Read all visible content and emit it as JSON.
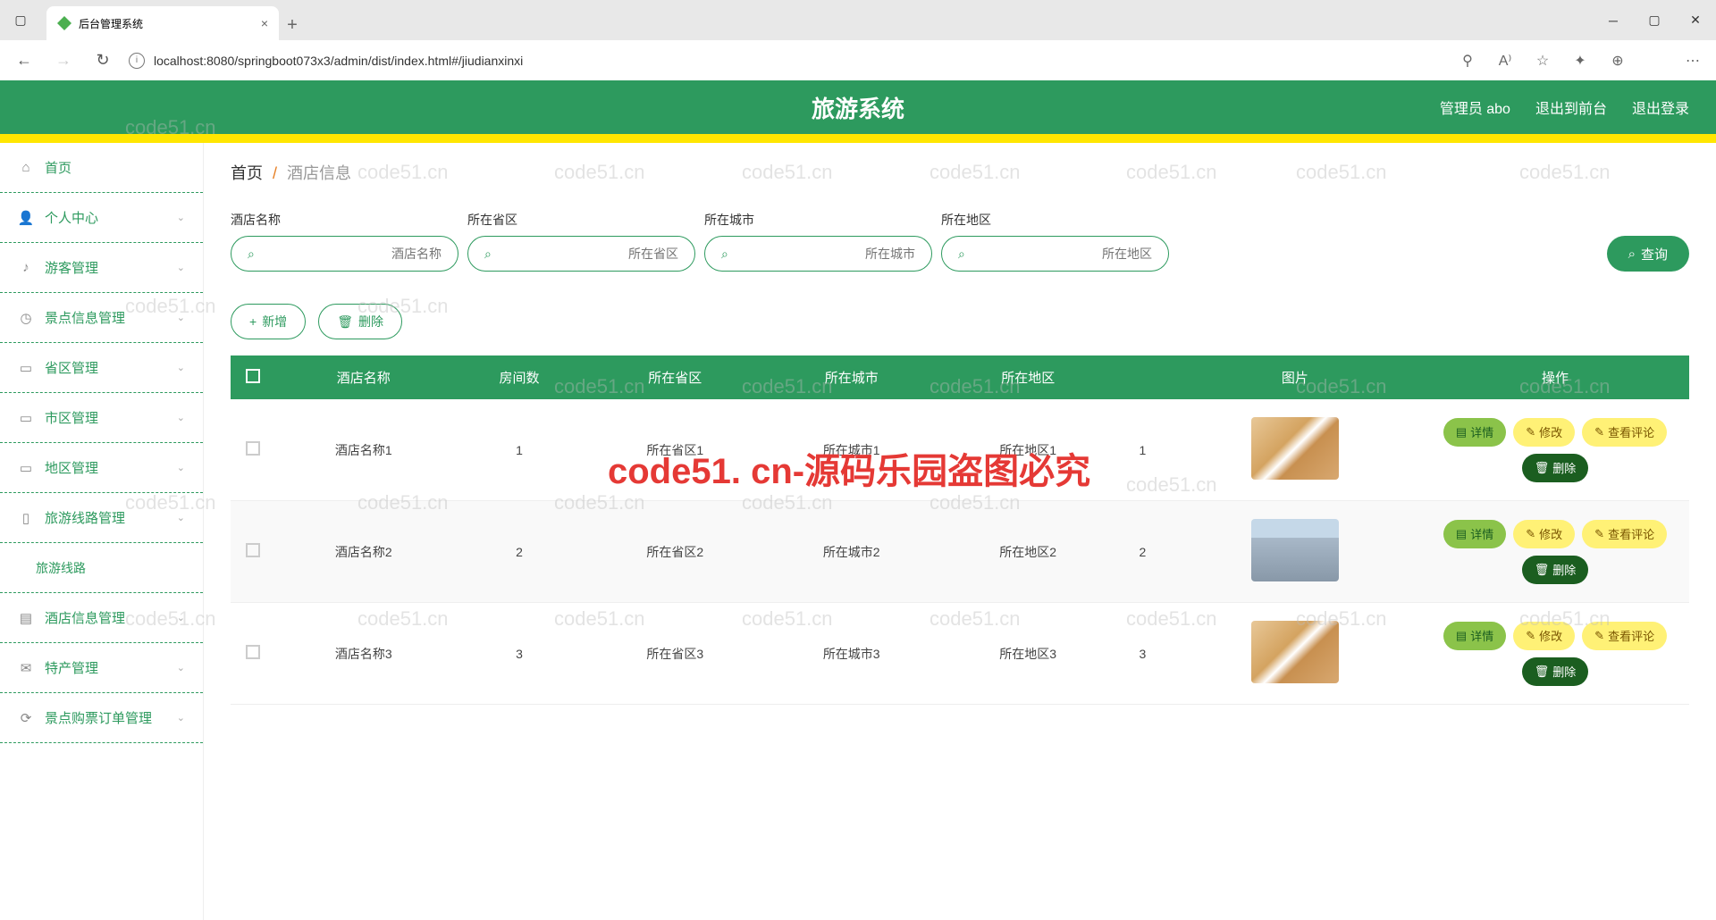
{
  "browser": {
    "tab_title": "后台管理系统",
    "url": "localhost:8080/springboot073x3/admin/dist/index.html#/jiudianxinxi"
  },
  "header": {
    "title": "旅游系统",
    "user": "管理员 abo",
    "to_front": "退出到前台",
    "logout": "退出登录"
  },
  "breadcrumb": {
    "home": "首页",
    "current": "酒店信息"
  },
  "sidebar": {
    "items": [
      {
        "label": "首页",
        "icon": "⌂"
      },
      {
        "label": "个人中心",
        "icon": "👤",
        "chev": true
      },
      {
        "label": "游客管理",
        "icon": "♪",
        "chev": true
      },
      {
        "label": "景点信息管理",
        "icon": "◷",
        "chev": true
      },
      {
        "label": "省区管理",
        "icon": "▭",
        "chev": true
      },
      {
        "label": "市区管理",
        "icon": "▭",
        "chev": true
      },
      {
        "label": "地区管理",
        "icon": "▭",
        "chev": true
      },
      {
        "label": "旅游线路管理",
        "icon": "▯",
        "chev": true
      },
      {
        "label": "旅游线路",
        "icon": "",
        "sub": true
      },
      {
        "label": "酒店信息管理",
        "icon": "▤",
        "chev": true
      },
      {
        "label": "特产管理",
        "icon": "✉",
        "chev": true
      },
      {
        "label": "景点购票订单管理",
        "icon": "⟳",
        "chev": true
      }
    ]
  },
  "search": {
    "fields": [
      {
        "label": "酒店名称",
        "placeholder": "酒店名称"
      },
      {
        "label": "所在省区",
        "placeholder": "所在省区"
      },
      {
        "label": "所在城市",
        "placeholder": "所在城市"
      },
      {
        "label": "所在地区",
        "placeholder": "所在地区"
      }
    ],
    "query_btn": "查询"
  },
  "actions": {
    "add": "新增",
    "delete": "删除"
  },
  "table": {
    "headers": [
      "",
      "酒店名称",
      "房间数",
      "所在省区",
      "所在城市",
      "所在地区",
      "",
      "图片",
      "操作"
    ],
    "rows": [
      {
        "name": "酒店名称1",
        "rooms": "1",
        "prov": "所在省区1",
        "city": "所在城市1",
        "area": "所在地区1",
        "num": "1",
        "img": "room"
      },
      {
        "name": "酒店名称2",
        "rooms": "2",
        "prov": "所在省区2",
        "city": "所在城市2",
        "area": "所在地区2",
        "num": "2",
        "img": "bldg"
      },
      {
        "name": "酒店名称3",
        "rooms": "3",
        "prov": "所在省区3",
        "city": "所在城市3",
        "area": "所在地区3",
        "num": "3",
        "img": "room"
      }
    ],
    "row_actions": {
      "detail": "详情",
      "edit": "修改",
      "comment": "查看评论",
      "delete": "删除"
    }
  },
  "watermark": {
    "small": "code51.cn",
    "big": "code51. cn-源码乐园盗图必究"
  }
}
